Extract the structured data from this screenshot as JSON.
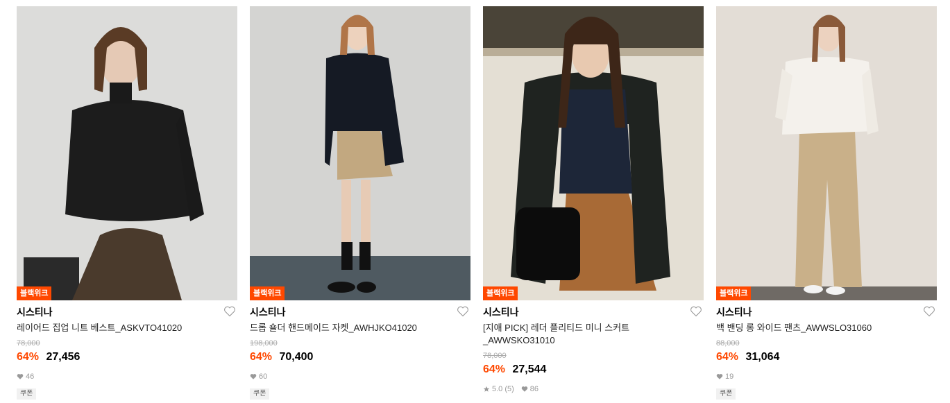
{
  "products": [
    {
      "badge": "블랙위크",
      "brand": "시스티나",
      "name": "레이어드 집업 니트 베스트_ASKVTO41020",
      "original_price": "78,000",
      "discount": "64%",
      "price": "27,456",
      "rating": "",
      "likes": "46",
      "tag": "쿠폰",
      "image_icon": "model-black-knit-vest-brown-skirt"
    },
    {
      "badge": "블랙위크",
      "brand": "시스티나",
      "name": "드롭 숄더 핸드메이드 자켓_AWHJKO41020",
      "original_price": "198,000",
      "discount": "64%",
      "price": "70,400",
      "rating": "",
      "likes": "60",
      "tag": "쿠폰",
      "image_icon": "model-navy-jacket-beige-skirt"
    },
    {
      "badge": "블랙위크",
      "brand": "시스티나",
      "name": "[지애 PICK] 레더 플리티드 미니 스커트_AWWSKO31010",
      "original_price": "78,000",
      "discount": "64%",
      "price": "27,544",
      "rating": "5.0 (5)",
      "likes": "86",
      "tag": "",
      "image_icon": "model-trench-coat-brown-skirt"
    },
    {
      "badge": "블랙위크",
      "brand": "시스티나",
      "name": "백 밴딩 롱 와이드 팬츠_AWWSLO31060",
      "original_price": "88,000",
      "discount": "64%",
      "price": "31,064",
      "rating": "",
      "likes": "19",
      "tag": "쿠폰",
      "image_icon": "model-white-shirt-beige-pants"
    }
  ],
  "colors": {
    "accent": "#ff4800",
    "muted": "#999999"
  }
}
